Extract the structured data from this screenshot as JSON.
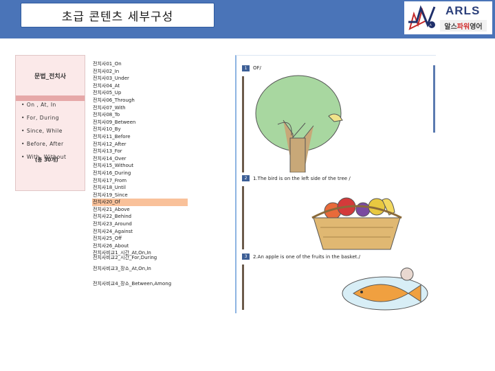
{
  "header": {
    "title": "초급 콘텐츠 세부구성",
    "logo": {
      "brand": "ARLS",
      "sub_a": "알스",
      "sub_b": "파워",
      "sub_c": "영어",
      "accent": "#d23030"
    }
  },
  "unit": {
    "title": "문법_전치사",
    "groups": [
      "On , At, In",
      "For, During",
      "Since, While",
      "Before, After",
      "With, Without"
    ],
    "count": "(총 30개)"
  },
  "lessons": [
    "전치사01_On",
    "전치사02_In",
    "전치사03_Under",
    "전치사04_At",
    "전치사05_Up",
    "전치사06_Through",
    "전치사07_With",
    "전치사08_To",
    "전치사09_Between",
    "전치사10_By",
    "전치사11_Before",
    "전치사12_After",
    "전치사13_For",
    "전치사14_Over",
    "전치사15_Without",
    "전치사16_During",
    "전치사17_From",
    "전치사18_Until",
    "전치사19_Since",
    "전치사20_Of",
    "전치사21_Above",
    "전치사22_Behind",
    "전치사23_Around",
    "전치사24_Against",
    "전치사25_Off",
    "전치사26_About",
    "전치사비교1_시간_At,On,In"
  ],
  "comparisons": [
    "전치사비교2_시간_For,During",
    "전치사비교3_장소_At,On,In",
    "전치사비교4_장소_Between,Among"
  ],
  "preview": {
    "items": [
      {
        "num": "1",
        "text": "OF/"
      },
      {
        "num": "2",
        "text": "1.The bird is on the left side of the tree /"
      },
      {
        "num": "3",
        "text": "2.An apple is one of the fruits in the basket./"
      }
    ]
  }
}
